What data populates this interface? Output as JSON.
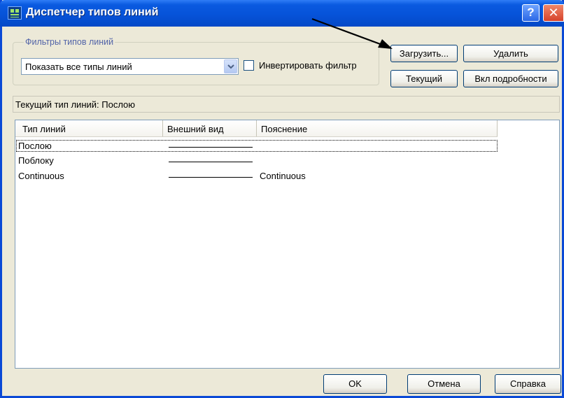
{
  "window": {
    "title": "Диспетчер типов линий",
    "help_label": "?",
    "close_label": "✕"
  },
  "filters": {
    "group_label": "Фильтры типов линий",
    "selected": "Показать все типы линий",
    "invert_label": "Инвертировать фильтр",
    "invert_checked": false
  },
  "buttons": {
    "load": "Загрузить...",
    "delete": "Удалить",
    "current": "Текущий",
    "details": "Вкл подробности",
    "ok": "OK",
    "cancel": "Отмена",
    "help": "Справка"
  },
  "current_linetype": "Текущий тип линий:  Послою",
  "table": {
    "columns": [
      "Тип линий",
      "Внешний вид",
      "Пояснение"
    ],
    "rows": [
      {
        "name": "Послою",
        "description": ""
      },
      {
        "name": "Поблоку",
        "description": ""
      },
      {
        "name": "Continuous",
        "description": "Continuous"
      }
    ]
  },
  "icons": {
    "app": "linetype-manager-icon",
    "combo_arrow": "chevron-down-icon",
    "annotation": "pointer-arrow-icon"
  },
  "colors": {
    "title_bar": "#0653d9",
    "dialog_bg": "#ece9d8",
    "close_button": "#d6422b",
    "group_label": "#5264a8"
  }
}
